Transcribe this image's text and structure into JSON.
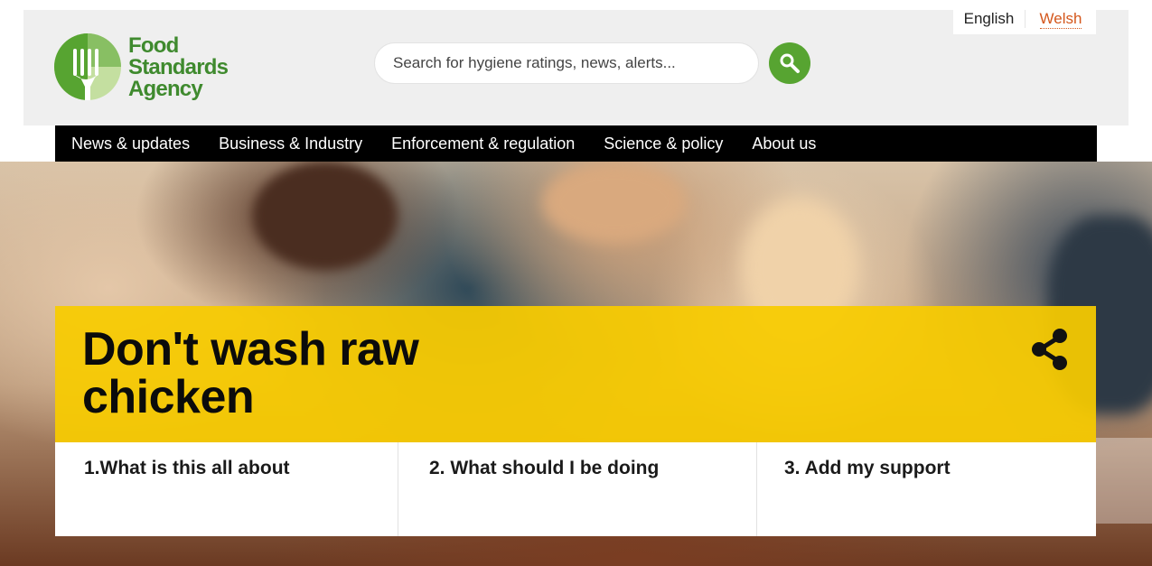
{
  "header": {
    "logo": {
      "lines": [
        "Food",
        "Standards",
        "Agency"
      ]
    },
    "search": {
      "placeholder": "Search for hygiene ratings, news, alerts...",
      "button_icon": "search-icon"
    },
    "language": {
      "english": "English",
      "welsh": "Welsh"
    }
  },
  "nav": {
    "items": [
      {
        "label": "News & updates"
      },
      {
        "label": "Business & Industry"
      },
      {
        "label": "Enforcement & regulation"
      },
      {
        "label": "Science & policy"
      },
      {
        "label": "About us"
      }
    ]
  },
  "hero": {
    "title": "Don't wash raw chicken",
    "share_icon": "share-icon",
    "steps": [
      {
        "label": "1.What is this all about"
      },
      {
        "label": "2. What should I be doing"
      },
      {
        "label": "3. Add my support"
      }
    ]
  },
  "colors": {
    "brand_green": "#57a431",
    "logo_green": "#3f8a2e",
    "banner_yellow": "#f7cb00",
    "nav_black": "#000000",
    "welsh_orange": "#d4571c"
  }
}
